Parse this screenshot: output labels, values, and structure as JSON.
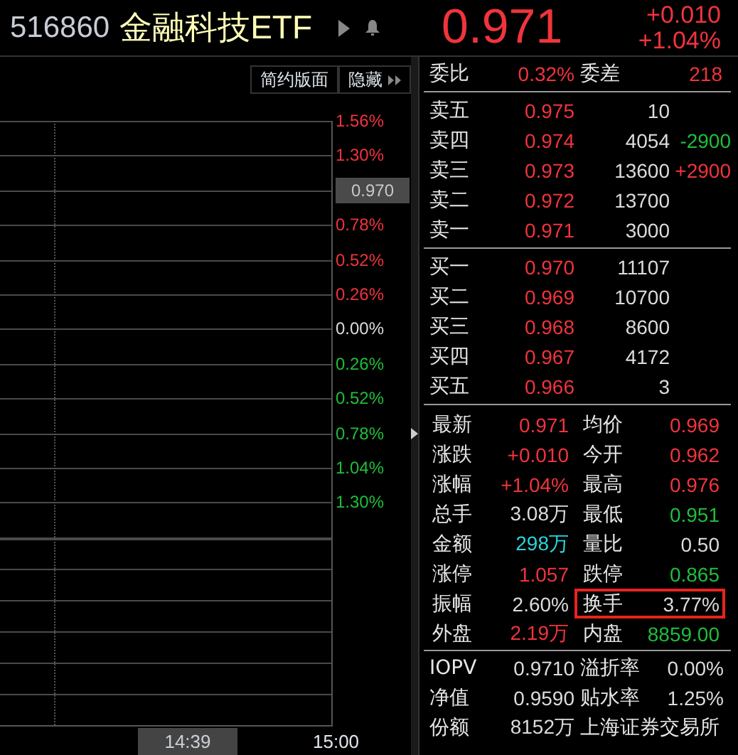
{
  "header": {
    "code": "516860",
    "name": "金融科技ETF",
    "price": "0.971",
    "change": "+0.010",
    "change_pct": "+1.04%"
  },
  "toolbar": {
    "buttons": [
      "简约版面",
      "隐藏"
    ]
  },
  "axis_labels": [
    {
      "text": "1.56%",
      "kind": "up"
    },
    {
      "text": "1.30%",
      "kind": "up"
    },
    {
      "text": "0.970",
      "kind": "cursor"
    },
    {
      "text": "0.78%",
      "kind": "up"
    },
    {
      "text": "0.52%",
      "kind": "up"
    },
    {
      "text": "0.26%",
      "kind": "up"
    },
    {
      "text": "0.00%",
      "kind": "flat"
    },
    {
      "text": "0.26%",
      "kind": "down"
    },
    {
      "text": "0.52%",
      "kind": "down"
    },
    {
      "text": "0.78%",
      "kind": "down"
    },
    {
      "text": "1.04%",
      "kind": "down"
    },
    {
      "text": "1.30%",
      "kind": "down"
    }
  ],
  "time_axis": {
    "cursor": "14:39",
    "end": "15:00"
  },
  "order_ratio": {
    "label": "委比",
    "value": "0.32%",
    "diff_label": "委差",
    "diff": "218"
  },
  "sell": [
    {
      "label": "卖五",
      "price": "0.975",
      "volume": "10"
    },
    {
      "label": "卖四",
      "price": "0.974",
      "volume": "4054",
      "delta": "-2900",
      "color": "#1fbf3a"
    },
    {
      "label": "卖三",
      "price": "0.973",
      "volume": "13600",
      "delta": "+2900",
      "color": "#f0343c"
    },
    {
      "label": "卖二",
      "price": "0.972",
      "volume": "13700"
    },
    {
      "label": "卖一",
      "price": "0.971",
      "volume": "3000"
    }
  ],
  "buy": [
    {
      "label": "买一",
      "price": "0.970",
      "volume": "11107"
    },
    {
      "label": "买二",
      "price": "0.969",
      "volume": "10700"
    },
    {
      "label": "买三",
      "price": "0.968",
      "volume": "8600"
    },
    {
      "label": "买四",
      "price": "0.967",
      "volume": "4172"
    },
    {
      "label": "买五",
      "price": "0.966",
      "volume": "3"
    }
  ],
  "stats": [
    {
      "label": "最新",
      "value": "0.971",
      "kind": "up",
      "highlighted": false
    },
    {
      "label": "均价",
      "value": "0.969",
      "kind": "up",
      "highlighted": false
    },
    {
      "label": "涨跌",
      "value": "+0.010",
      "kind": "up",
      "highlighted": false
    },
    {
      "label": "今开",
      "value": "0.962",
      "kind": "up",
      "highlighted": false
    },
    {
      "label": "涨幅",
      "value": "+1.04%",
      "kind": "up",
      "highlighted": false
    },
    {
      "label": "最高",
      "value": "0.976",
      "kind": "up",
      "highlighted": false
    },
    {
      "label": "总手",
      "value": "3.08万",
      "kind": "flat",
      "highlighted": false
    },
    {
      "label": "最低",
      "value": "0.951",
      "kind": "down",
      "highlighted": false
    },
    {
      "label": "金额",
      "value": "298万",
      "kind": "amount",
      "highlighted": false
    },
    {
      "label": "量比",
      "value": "0.50",
      "kind": "flat",
      "highlighted": false
    },
    {
      "label": "涨停",
      "value": "1.057",
      "kind": "up",
      "highlighted": false
    },
    {
      "label": "跌停",
      "value": "0.865",
      "kind": "down",
      "highlighted": false
    },
    {
      "label": "振幅",
      "value": "2.60%",
      "kind": "flat",
      "highlighted": false
    },
    {
      "label": "换手",
      "value": "3.77%",
      "kind": "flat",
      "highlighted": true
    },
    {
      "label": "外盘",
      "value": "2.19万",
      "kind": "up",
      "highlighted": false
    },
    {
      "label": "内盘",
      "value": "8859.00",
      "kind": "down",
      "highlighted": false
    }
  ],
  "fund": [
    {
      "label": "IOPV",
      "value": "0.9710"
    },
    {
      "label": "溢折率",
      "value": "0.00%"
    },
    {
      "label": "净值",
      "value": "0.9590"
    },
    {
      "label": "贴水率",
      "value": "1.25%"
    },
    {
      "label": "份额",
      "value": "8152万"
    },
    {
      "label": "上海证券交易所"
    }
  ]
}
